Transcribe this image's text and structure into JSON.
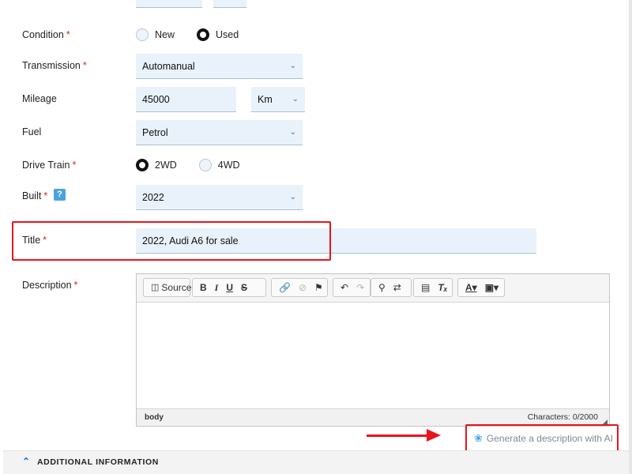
{
  "form": {
    "condition": {
      "label": "Condition",
      "required": "*",
      "options": [
        "New",
        "Used"
      ],
      "selected": "Used"
    },
    "transmission": {
      "label": "Transmission",
      "required": "*",
      "value": "Automanual"
    },
    "mileage": {
      "label": "Mileage",
      "value": "45000",
      "unit": "Km"
    },
    "fuel": {
      "label": "Fuel",
      "value": "Petrol"
    },
    "drive_train": {
      "label": "Drive Train",
      "required": "*",
      "options": [
        "2WD",
        "4WD"
      ],
      "selected": "2WD"
    },
    "built": {
      "label": "Built",
      "required": "*",
      "help": "?",
      "value": "2022"
    },
    "title": {
      "label": "Title",
      "required": "*",
      "value": "2022, Audi A6 for sale"
    },
    "description": {
      "label": "Description",
      "required": "*",
      "toolbar": {
        "source": "Source"
      },
      "status_path": "body",
      "char_count": "Characters: 0/2000"
    }
  },
  "ai_button": {
    "label": "Generate a description with AI",
    "icon": "openai-logo-icon"
  },
  "section": {
    "title": "ADDITIONAL INFORMATION",
    "icon": "chevron-up-icon"
  },
  "colors": {
    "highlight": "#e8141c",
    "input_bg": "#e9f2fb",
    "help_badge": "#4aa3df",
    "required": "#d9261c"
  }
}
